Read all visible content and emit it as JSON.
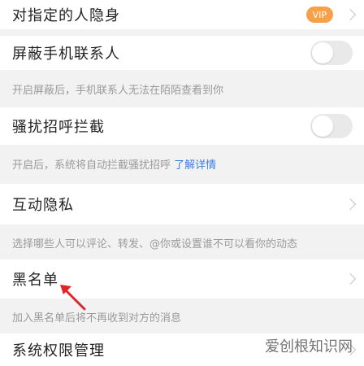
{
  "rows": {
    "hide_from_specific": {
      "label": "对指定的人隐身",
      "badge": "VIP"
    },
    "block_contacts": {
      "label": "屏蔽手机联系人",
      "hint": "开启屏蔽后，手机联系人无法在陌陌查看到你",
      "toggle_on": false
    },
    "harass_block": {
      "label": "骚扰招呼拦截",
      "hint": "开启后，系统将自动拦截骚扰招呼",
      "hint_link": "了解详情",
      "toggle_on": false
    },
    "interaction_privacy": {
      "label": "互动隐私",
      "hint": "选择哪些人可以评论、转发、@你或设置谁不可以看你的动态"
    },
    "blacklist": {
      "label": "黑名单",
      "hint": "加入黑名单后将不再收到对方的消息"
    },
    "system_permissions": {
      "label": "系统权限管理"
    }
  },
  "watermark": "爱创根知识网",
  "colors": {
    "accent_link": "#3b7ee0",
    "vip_badge": "#f7a04b",
    "arrow": "#e0242a"
  }
}
